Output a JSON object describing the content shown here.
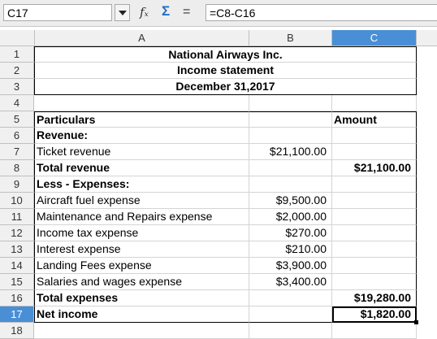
{
  "formula_bar": {
    "name_box": "C17",
    "formula": "=C8-C16",
    "icons": [
      "function-wizard-icon",
      "sum-icon",
      "equals-icon"
    ]
  },
  "columns": [
    "A",
    "B",
    "C"
  ],
  "active_column": "C",
  "active_row": "17",
  "rows": [
    "1",
    "2",
    "3",
    "4",
    "5",
    "6",
    "7",
    "8",
    "9",
    "10",
    "11",
    "12",
    "13",
    "14",
    "15",
    "16",
    "17",
    "18"
  ],
  "title": {
    "company": "National Airways Inc.",
    "statement": "Income statement",
    "date": "December 31,2017"
  },
  "table": {
    "r5": {
      "a": "Particulars",
      "c": "Amount"
    },
    "r6": {
      "a": "Revenue:"
    },
    "r7": {
      "a": "Ticket revenue",
      "b": "$21,100.00"
    },
    "r8": {
      "a": "Total revenue",
      "c": "$21,100.00"
    },
    "r9": {
      "a": "Less - Expenses:"
    },
    "r10": {
      "a": "Aircraft fuel expense",
      "b": "$9,500.00"
    },
    "r11": {
      "a": "Maintenance and Repairs expense",
      "b": "$2,000.00"
    },
    "r12": {
      "a": "Income tax expense",
      "b": "$270.00"
    },
    "r13": {
      "a": "Interest expense",
      "b": "$210.00"
    },
    "r14": {
      "a": "Landing Fees expense",
      "b": "$3,900.00"
    },
    "r15": {
      "a": "Salaries and wages expense",
      "b": "$3,400.00"
    },
    "r16": {
      "a": "Total expenses",
      "c": "$19,280.00"
    },
    "r17": {
      "a": "Net income",
      "c": "$1,820.00"
    }
  },
  "colors": {
    "header_active": "#4a8fd6",
    "grid": "#d4d4d4"
  }
}
